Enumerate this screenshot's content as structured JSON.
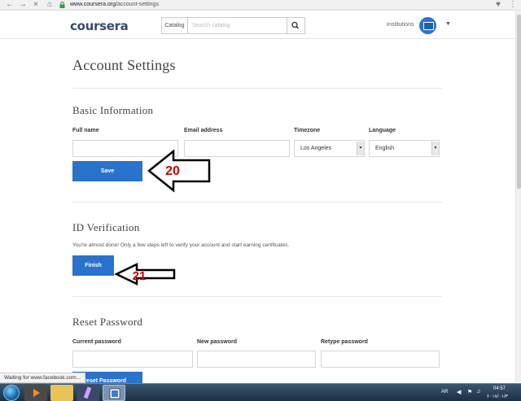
{
  "browser": {
    "url_host": "www.coursera.org",
    "url_path": "/account-settings",
    "status_text": "Waiting for www.facebook.com..."
  },
  "header": {
    "logo": "coursera",
    "catalog_label": "Catalog",
    "search_placeholder": "Search catalog",
    "institutions_label": "Institutions"
  },
  "page": {
    "title": "Account Settings"
  },
  "basic_info": {
    "title": "Basic Information",
    "full_name_label": "Full name",
    "email_label": "Email address",
    "timezone_label": "Timezone",
    "timezone_value": "Los Angeles",
    "language_label": "Language",
    "language_value": "English",
    "save_label": "Save"
  },
  "id_verification": {
    "title": "ID Verification",
    "helper": "You're almost done! Only a few steps left to verify your account and start earning certificates.",
    "finish_label": "Finish"
  },
  "reset_password": {
    "title": "Reset Password",
    "current_label": "Current password",
    "new_label": "New password",
    "retype_label": "Retype password",
    "button_label": "Reset Password"
  },
  "annotations": {
    "arrow_1": "20",
    "arrow_2": "21"
  },
  "taskbar": {
    "lang": "AR",
    "time": "04:57",
    "date": "٢٠١٧/٠١/٣"
  },
  "colors": {
    "primary": "#2a73cc",
    "annotation": "#cc0000"
  }
}
